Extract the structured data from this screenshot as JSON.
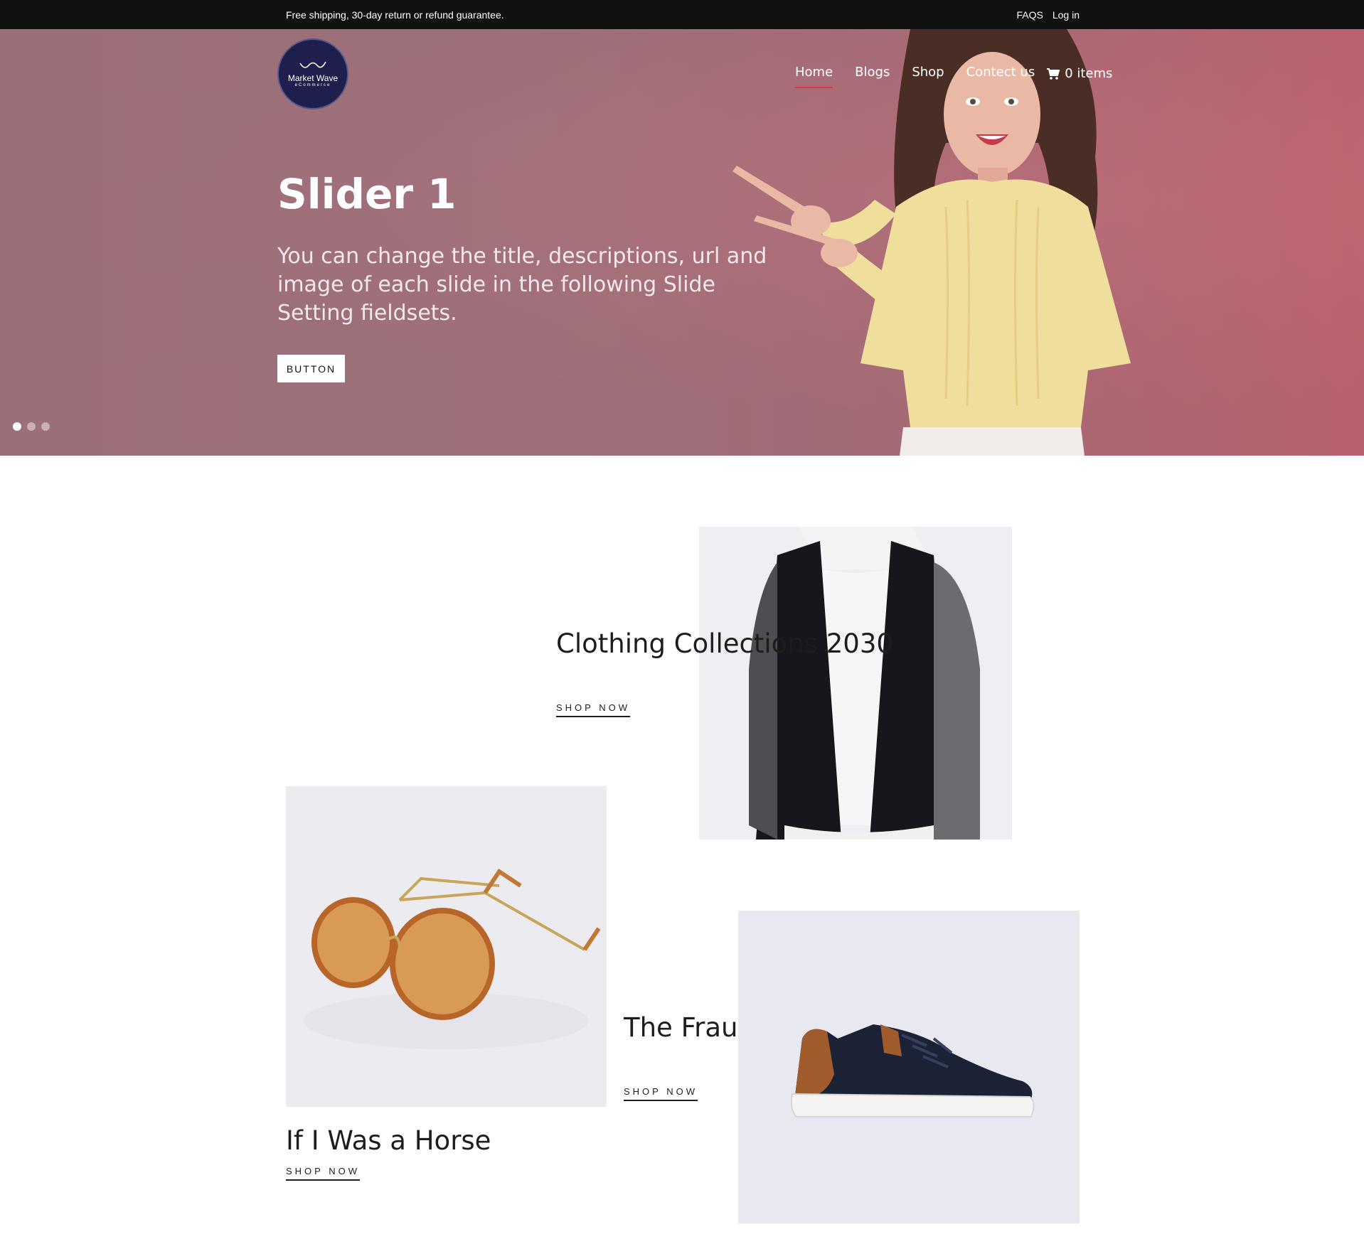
{
  "topbar": {
    "message": "Free shipping, 30-day return or refund guarantee.",
    "faqs": "FAQS",
    "login": "Log in"
  },
  "header": {
    "logo_brand": "Market Wave",
    "logo_sub": "eCommerce",
    "nav": [
      "Home",
      "Blogs",
      "Shop",
      "Contect us"
    ],
    "active_nav": "Home",
    "cart_label": "0 items"
  },
  "hero": {
    "title": "Slider 1",
    "description": "You can change the title, descriptions, url and image of each slide in the following Slide Setting fieldsets.",
    "button": "BUTTON",
    "slide_count": 3,
    "active_slide": 1
  },
  "collections": [
    {
      "title": "Clothing Collections 2030",
      "link": "SHOP NOW"
    },
    {
      "title": "The Fraud: A Novel",
      "link": "SHOP NOW"
    },
    {
      "title": "If I Was a Horse",
      "link": "SHOP NOW"
    }
  ],
  "colors": {
    "topbar_bg": "#111111",
    "hero_bg": "#9d7079",
    "nav_active_underline": "#e0333f",
    "logo_bg": "#1f1f4d"
  }
}
